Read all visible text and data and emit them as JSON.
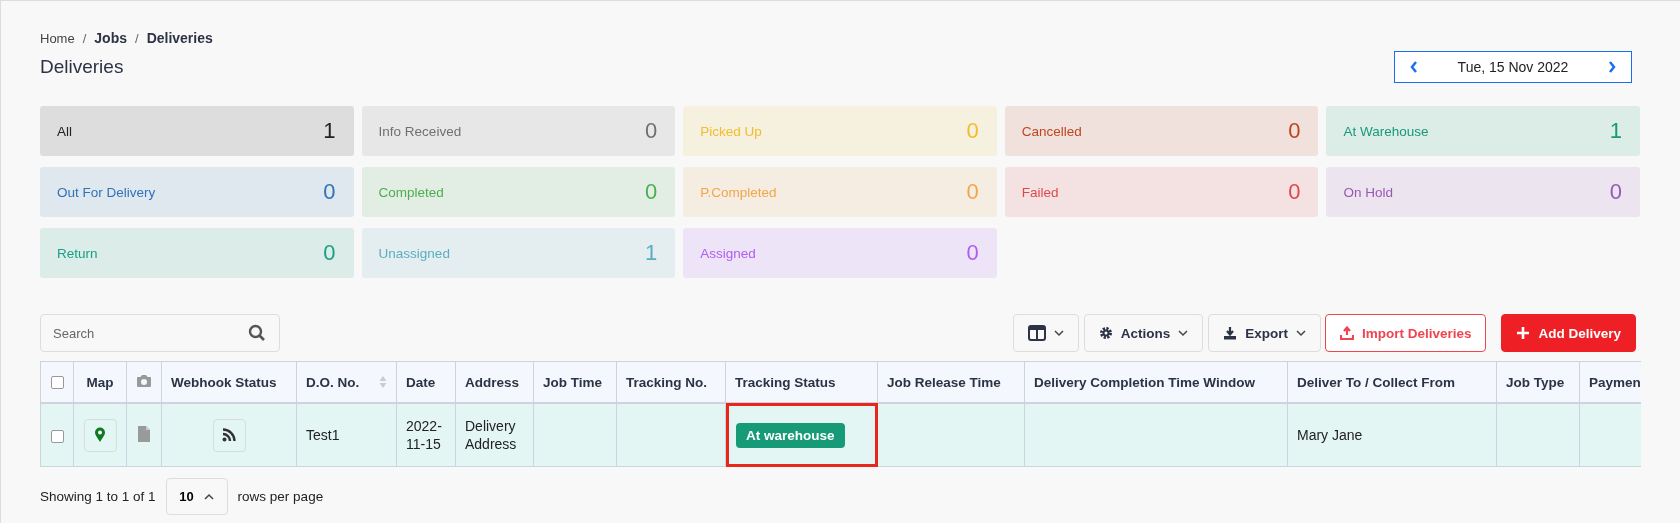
{
  "breadcrumb": [
    {
      "label": "Home",
      "current": false
    },
    {
      "separator": "/",
      "label": "Jobs",
      "current": true
    },
    {
      "separator": "/",
      "label": "Deliveries",
      "current": true
    }
  ],
  "page_title": "Deliveries",
  "date_nav": {
    "date": "Tue, 15 Nov 2022"
  },
  "status_cards": [
    {
      "label": "All",
      "count": "1",
      "color": "#222222"
    },
    {
      "label": "Info Received",
      "count": "0",
      "color": "#707070"
    },
    {
      "label": "Picked Up",
      "count": "0",
      "color": "#f2bd2c"
    },
    {
      "label": "Cancelled",
      "count": "0",
      "color": "#c0451f"
    },
    {
      "label": "At Warehouse",
      "count": "1",
      "color": "#179a77"
    },
    {
      "label": "Out For Delivery",
      "count": "0",
      "color": "#2f74b5"
    },
    {
      "label": "Completed",
      "count": "0",
      "color": "#4cae4f"
    },
    {
      "label": "P.Completed",
      "count": "0",
      "color": "#f2a64a"
    },
    {
      "label": "Failed",
      "count": "0",
      "color": "#e04848"
    },
    {
      "label": "On Hold",
      "count": "0",
      "color": "#9b59b6"
    },
    {
      "label": "Return",
      "count": "0",
      "color": "#17a085"
    },
    {
      "label": "Unassigned",
      "count": "1",
      "color": "#5aaec0"
    },
    {
      "label": "Assigned",
      "count": "0",
      "color": "#b05cf5"
    }
  ],
  "search": {
    "placeholder": "Search"
  },
  "toolbar": [
    {
      "kind": "columns"
    },
    {
      "kind": "actions",
      "label": "Actions"
    },
    {
      "kind": "export",
      "label": "Export"
    },
    {
      "kind": "outline",
      "label": "Import Deliveries"
    },
    {
      "kind": "primary",
      "label": "Add Delivery"
    }
  ],
  "table": {
    "columns": [
      {
        "kind": "checkbox",
        "checked": false
      },
      {
        "kind": "text",
        "label": "Map"
      },
      {
        "kind": "camera"
      },
      {
        "kind": "text",
        "label": "Webhook Status"
      },
      {
        "kind": "sortable",
        "label": "D.O. No."
      },
      {
        "kind": "text",
        "label": "Date"
      },
      {
        "kind": "text",
        "label": "Address"
      },
      {
        "kind": "text",
        "label": "Job Time"
      },
      {
        "kind": "text",
        "label": "Tracking No."
      },
      {
        "kind": "text",
        "label": "Tracking Status"
      },
      {
        "kind": "text",
        "label": "Job Release Time"
      },
      {
        "kind": "text",
        "label": "Delivery Completion Time Window"
      },
      {
        "kind": "text",
        "label": "Deliver To / Collect From"
      },
      {
        "kind": "text",
        "label": "Job Type"
      },
      {
        "kind": "text",
        "label": "Paymen"
      }
    ],
    "rows": [
      {
        "cells": [
          {
            "kind": "checkbox",
            "checked": false
          },
          {
            "kind": "map"
          },
          {
            "kind": "document"
          },
          {
            "kind": "webhook"
          },
          {
            "kind": "text",
            "text": "Test1"
          },
          {
            "kind": "text",
            "text": "2022-11-15"
          },
          {
            "kind": "text",
            "text": "Delivery Address"
          },
          {
            "kind": "empty"
          },
          {
            "kind": "empty"
          },
          {
            "kind": "status",
            "text": "At warehouse",
            "color": "#179a77",
            "highlighted": true
          },
          {
            "kind": "empty"
          },
          {
            "kind": "empty"
          },
          {
            "kind": "text",
            "text": "Mary Jane"
          },
          {
            "kind": "empty"
          },
          {
            "kind": "empty"
          }
        ]
      }
    ]
  },
  "pagination": {
    "summary": "Showing 1 to 1 of 1",
    "page_size": "10",
    "suffix": "rows per page"
  }
}
